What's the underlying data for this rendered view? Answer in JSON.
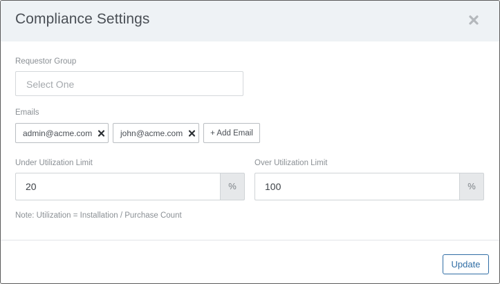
{
  "modal": {
    "title": "Compliance Settings",
    "close_icon": "close-icon"
  },
  "requestor_group": {
    "label": "Requestor Group",
    "placeholder": "Select One"
  },
  "emails": {
    "label": "Emails",
    "items": [
      {
        "address": "admin@acme.com",
        "remove_icon": "remove-icon"
      },
      {
        "address": "john@acme.com",
        "remove_icon": "remove-icon"
      }
    ],
    "add_label": "+ Add Email"
  },
  "under_utilization": {
    "label": "Under Utilization Limit",
    "value": "20",
    "unit": "%"
  },
  "over_utilization": {
    "label": "Over Utilization Limit",
    "value": "100",
    "unit": "%"
  },
  "note": "Note: Utilization = Installation / Purchase Count",
  "footer": {
    "update_label": "Update"
  },
  "colors": {
    "header_bg": "#eef2f5",
    "primary": "#2e6ca4",
    "addon_bg": "#e6e8ea"
  }
}
